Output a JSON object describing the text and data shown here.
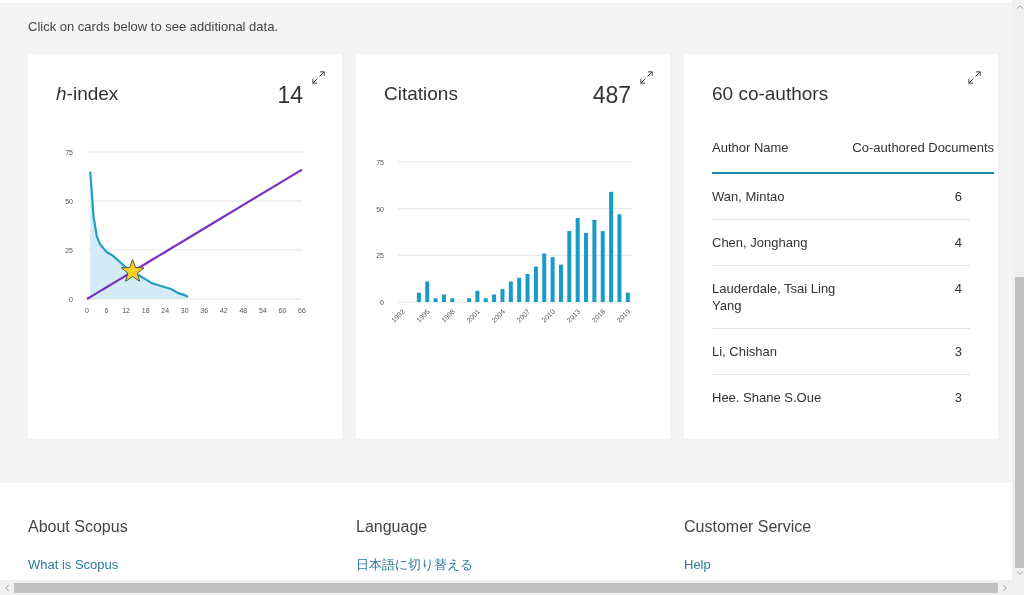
{
  "intro": "Click on cards below to see additional data.",
  "cards": [
    {
      "kind": "hindex",
      "title": "*h*-index",
      "value": "14",
      "chart_data": {
        "type": "line",
        "x": [
          0,
          1,
          2,
          3,
          4,
          6,
          8,
          10,
          12,
          14,
          16,
          18,
          20,
          22,
          24,
          26,
          28,
          30,
          31,
          66
        ],
        "series": [
          {
            "color": "#1f9fc4",
            "values": [
              null,
              65,
              42,
              32,
              28,
              24,
              22,
              19,
              16,
              14,
              12,
              10,
              8,
              7,
              6,
              5,
              3,
              2,
              1,
              null
            ]
          },
          {
            "color": "#7b2fbe",
            "values": [
              0,
              1,
              2,
              3,
              4,
              6,
              8,
              10,
              12,
              14,
              16,
              18,
              20,
              22,
              24,
              26,
              28,
              30,
              31,
              66
            ]
          }
        ],
        "xlim": [
          0,
          66
        ],
        "ylim": [
          0,
          75
        ],
        "xticks": [
          0,
          6,
          12,
          18,
          24,
          30,
          36,
          42,
          48,
          54,
          60,
          66
        ],
        "yticks": [
          0,
          25,
          50,
          75
        ]
      }
    },
    {
      "kind": "citations",
      "title": "Citations",
      "value": "487",
      "chart_data": {
        "type": "bar",
        "x": [
          1994,
          1995,
          1996,
          1997,
          1998,
          2000,
          2001,
          2002,
          2003,
          2004,
          2005,
          2006,
          2007,
          2008,
          2009,
          2010,
          2011,
          2012,
          2013,
          2014,
          2015,
          2016,
          2017,
          2018,
          2019
        ],
        "series": [
          {
            "color": "#1a9bc4",
            "values": [
              5,
              11,
              2,
              4,
              2,
              2,
              6,
              2,
              4,
              7,
              11,
              13,
              15,
              19,
              26,
              24,
              20,
              38,
              45,
              37,
              44,
              38,
              59,
              47,
              5
            ]
          }
        ],
        "xlim": [
          1991.5,
          2019.5
        ],
        "ylim": [
          0,
          75
        ],
        "yticks": [
          0,
          25,
          50,
          75
        ],
        "xticks": [
          1992,
          1995,
          1998,
          2001,
          2004,
          2007,
          2010,
          2013,
          2016,
          2019
        ]
      }
    },
    {
      "kind": "coauthors",
      "title": "60 co-authors",
      "columns": [
        "Author Name",
        "Co-authored Documents"
      ],
      "rows": [
        {
          "name": "Wan, Mintao",
          "count": "6"
        },
        {
          "name": "Chen, Jonghang",
          "count": "4"
        },
        {
          "name": "Lauderdale, Tsai Ling Yang",
          "count": "4"
        },
        {
          "name": "Li, Chishan",
          "count": "3"
        },
        {
          "name": "Hee. Shane S.Oue",
          "count": "3"
        }
      ]
    }
  ],
  "footer": {
    "columns": [
      {
        "heading": "About Scopus",
        "links": [
          "What is Scopus"
        ]
      },
      {
        "heading": "Language",
        "links": [
          "日本語に切り替える"
        ]
      },
      {
        "heading": "Customer Service",
        "links": [
          "Help"
        ]
      }
    ]
  }
}
